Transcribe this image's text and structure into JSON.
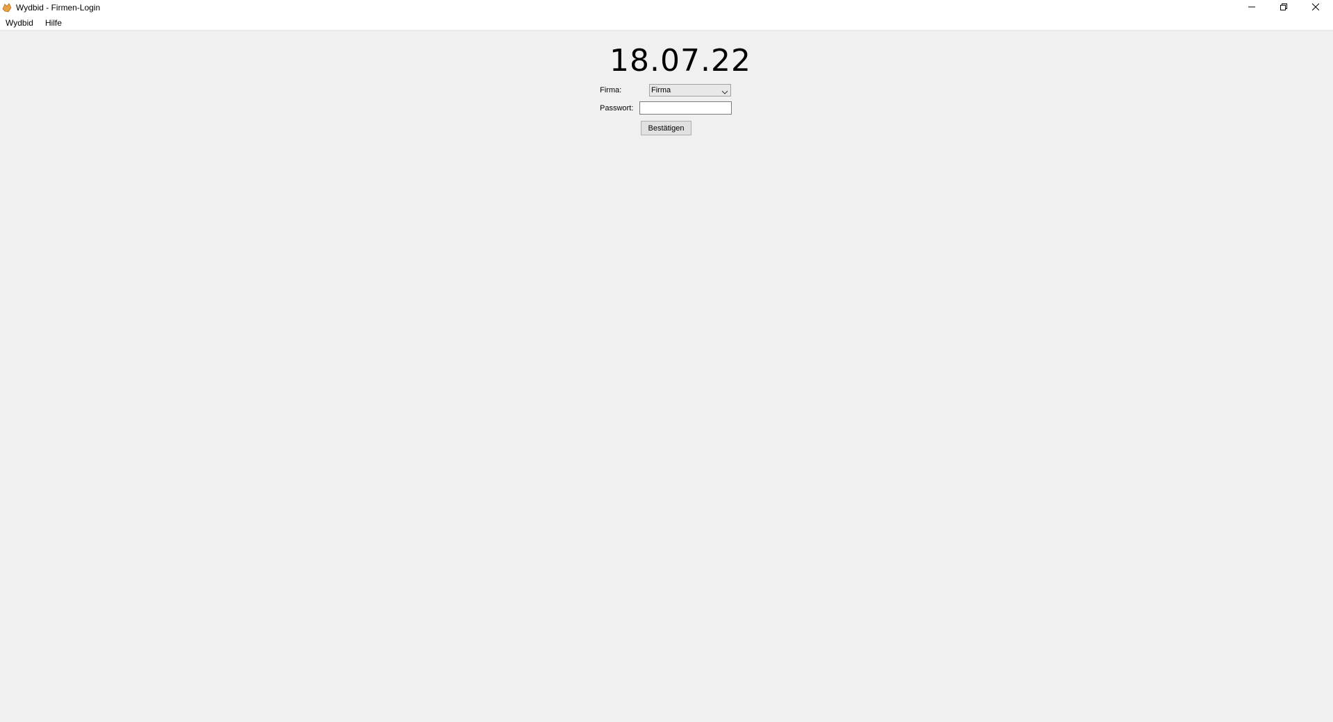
{
  "window": {
    "title": "Wydbid - Firmen-Login",
    "icon": "app-logo-icon",
    "controls": [
      "minimize-icon",
      "restore-icon",
      "close-icon"
    ]
  },
  "menubar": {
    "items": [
      "Wydbid",
      "Hilfe"
    ]
  },
  "login": {
    "date": "18.07.22",
    "company_label": "Firma:",
    "company_value": "Firma",
    "password_label": "Passwort:",
    "password_value": "",
    "confirm_label": "Bestätigen"
  },
  "colors": {
    "background": "#f0f0f0",
    "titlebar": "#ffffff",
    "accent_icon": "#e8a040"
  }
}
